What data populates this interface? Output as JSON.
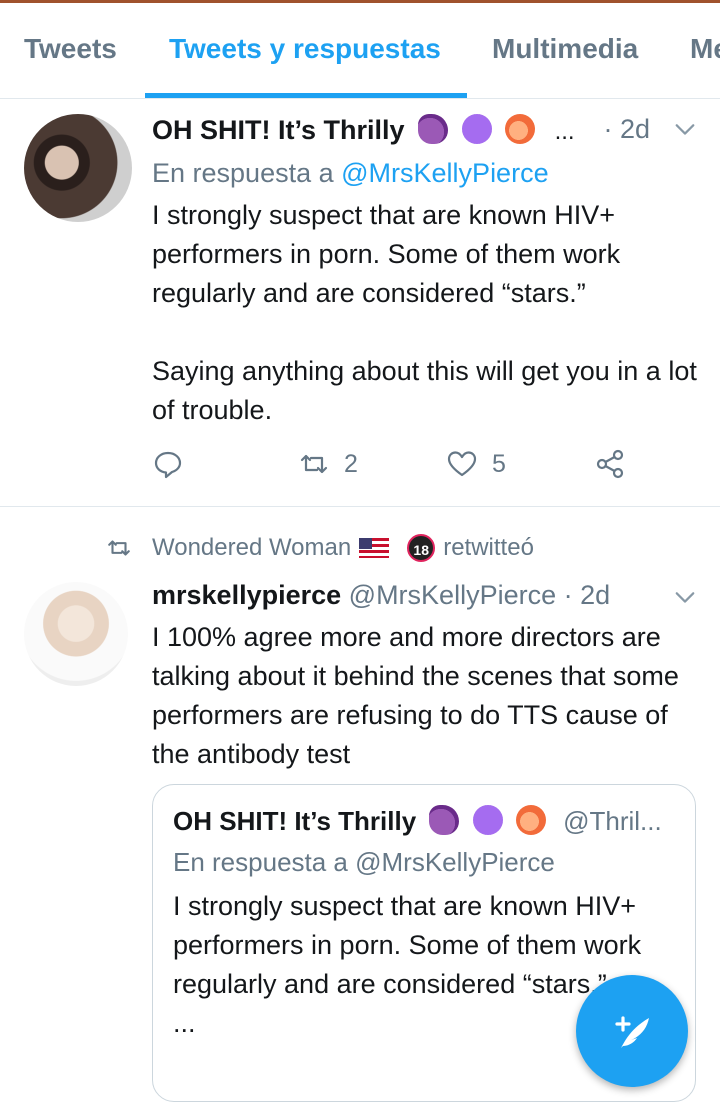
{
  "tabs": [
    {
      "label": "Tweets"
    },
    {
      "label": "Tweets y respuestas"
    },
    {
      "label": "Multimedia"
    },
    {
      "label": "Me"
    }
  ],
  "tweet1": {
    "display_name": "OH SHIT! It’s Thrilly",
    "name_ellipsis": "...",
    "time": "· 2d",
    "reply_prefix": "En respuesta a",
    "reply_mention": "@MrsKellyPierce",
    "body_p1": "I strongly suspect that are known HIV+ performers in porn. Some of them work regularly and are considered “stars.”",
    "body_p2": "Saying anything about this will get you in a lot of trouble.",
    "retweets": "2",
    "likes": "5"
  },
  "tweet2": {
    "retweeter": "Wondered Woman",
    "badge": "18",
    "retweet_label": "retwitteó",
    "display_name": "mrskellypierce",
    "handle": "@MrsKellyPierce",
    "time": "· 2d",
    "body": "I 100% agree more and more directors are talking about it behind the scenes that some performers are refusing to do TTS cause of the antibody test"
  },
  "quoted": {
    "display_name": "OH SHIT! It’s Thrilly",
    "handle": "@Thril...",
    "reply_prefix": "En respuesta a",
    "reply_mention": "@MrsKellyPierce",
    "body": "I strongly suspect that are known HIV+ performers in porn. Some of them work regularly and are considered “stars.”",
    "ellipsis": "..."
  },
  "colors": {
    "accent": "#1da1f2",
    "secondary_text": "#657786",
    "divider": "#e1e8ed"
  }
}
